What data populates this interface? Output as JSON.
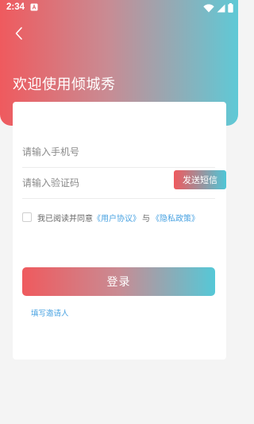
{
  "status_bar": {
    "time": "2:34"
  },
  "header": {
    "title": "欢迎使用倾城秀"
  },
  "form": {
    "phone_placeholder": "请输入手机号",
    "code_placeholder": "请输入验证码",
    "send_sms_label": "发送短信",
    "agreement_prefix": "我已阅读并同意",
    "user_agreement": "《用户协议》",
    "and_text": "与",
    "privacy_policy": "《隐私政策》",
    "login_label": "登录",
    "invite_label": "填写邀请人"
  },
  "colors": {
    "gradient_start": "#ef5a5e",
    "gradient_end": "#5fc9d6",
    "link": "#4aa3e2",
    "background": "#f4f4f4"
  }
}
